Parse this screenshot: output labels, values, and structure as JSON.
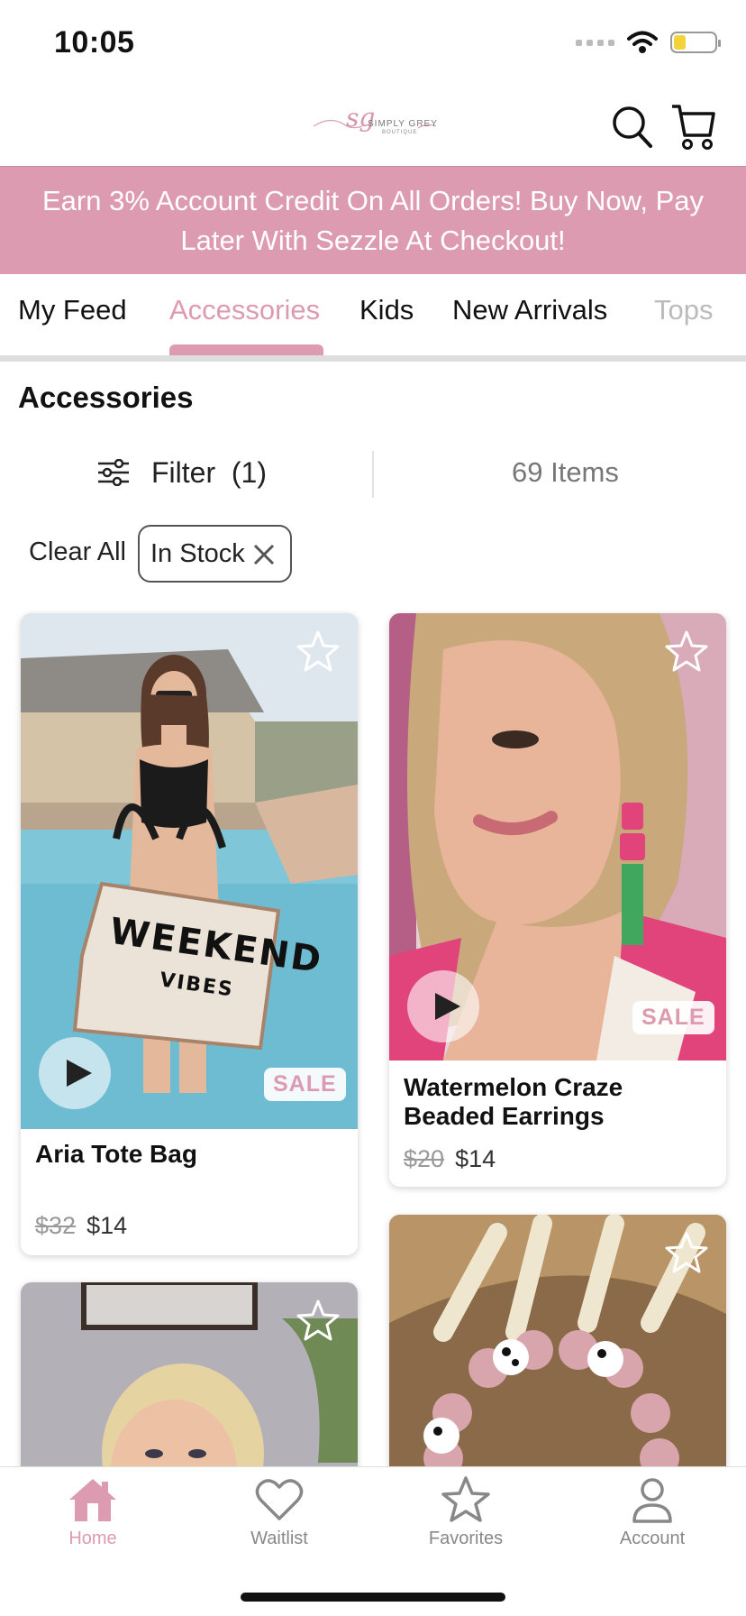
{
  "status_bar": {
    "time": "10:05"
  },
  "header": {
    "logo_script": "sg",
    "logo_text": "SIMPLY GREY",
    "logo_sub": "BOUTIQUE"
  },
  "promo": {
    "text": "Earn 3% Account Credit On All Orders! Buy Now, Pay Later With Sezzle At Checkout!"
  },
  "tabs": [
    {
      "label": "My Feed",
      "active": false
    },
    {
      "label": "Accessories",
      "active": true
    },
    {
      "label": "Kids",
      "active": false
    },
    {
      "label": "New Arrivals",
      "active": false
    },
    {
      "label": "Tops",
      "active": false
    }
  ],
  "section": {
    "title": "Accessories",
    "filter_label": "Filter",
    "filter_count": "(1)",
    "item_count": "69 Items",
    "clear_all": "Clear All",
    "active_filter": "In Stock"
  },
  "products": [
    {
      "name": "Aria Tote Bag",
      "old_price": "$32",
      "price": "$14",
      "sale_badge": "SALE",
      "has_video": true,
      "bag_text_1": "WEEKEND",
      "bag_text_2": "VIBES"
    },
    {
      "name": "Watermelon Craze Beaded Earrings",
      "old_price": "$20",
      "price": "$14",
      "sale_badge": "SALE",
      "has_video": true
    },
    {
      "name": "",
      "partial": true
    },
    {
      "name": "",
      "partial": true
    }
  ],
  "bottom_nav": [
    {
      "label": "Home",
      "icon": "home-icon",
      "active": true
    },
    {
      "label": "Waitlist",
      "icon": "heart-icon",
      "active": false
    },
    {
      "label": "Favorites",
      "icon": "star-icon",
      "active": false
    },
    {
      "label": "Account",
      "icon": "person-icon",
      "active": false
    }
  ],
  "colors": {
    "brand_pink": "#dc9bb1",
    "text": "#111111",
    "muted": "#888888"
  }
}
